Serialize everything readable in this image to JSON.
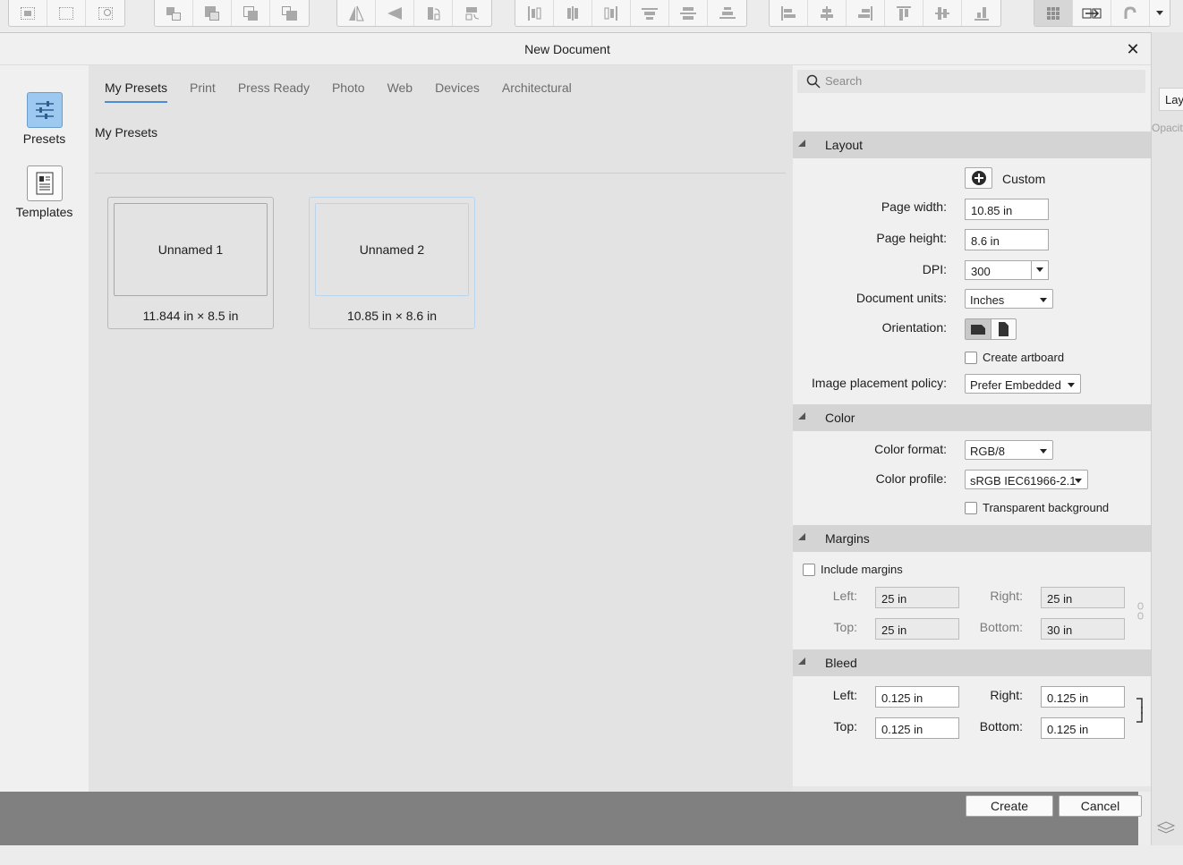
{
  "toolbar": {
    "groups": [
      {
        "name": "selection",
        "icons": [
          "select-all-icon",
          "deselect-icon",
          "invert-selection-icon"
        ]
      },
      {
        "name": "arrange",
        "icons": [
          "move-to-back-icon",
          "move-back-one-icon",
          "move-forward-one-icon",
          "move-to-front-icon"
        ]
      },
      {
        "name": "transform",
        "icons": [
          "flip-horizontal-icon",
          "flip-vertical-icon",
          "rotate-left-icon",
          "rotate-right-icon"
        ]
      },
      {
        "name": "distribute",
        "icons": [
          "align-left-icon",
          "align-center-icon",
          "align-right-icon",
          "distribute-top-icon",
          "distribute-middle-icon",
          "distribute-bottom-icon"
        ]
      },
      {
        "name": "align",
        "icons": [
          "align-left-edge-icon",
          "align-h-center-icon",
          "align-right-edge-icon",
          "align-top-icon",
          "align-v-center-icon",
          "align-bottom-icon"
        ]
      },
      {
        "name": "snapping",
        "icons": [
          "grid-icon",
          "swap-icon",
          "snapping-magnet-icon",
          "dropdown-arrow-icon"
        ]
      }
    ]
  },
  "side_panel": {
    "tab_label": "Layers",
    "opacity_label": "Opacity"
  },
  "dialog": {
    "title": "New Document",
    "close_symbol": "✕",
    "nav": [
      {
        "label": "Presets",
        "icon": "presets-sliders-icon"
      },
      {
        "label": "Templates",
        "icon": "templates-doc-icon"
      }
    ],
    "tabs": [
      "My Presets",
      "Print",
      "Press Ready",
      "Photo",
      "Web",
      "Devices",
      "Architectural"
    ],
    "section_label": "My Presets",
    "presets": [
      {
        "name": "Unnamed 1",
        "size": "11.844 in × 8.5 in"
      },
      {
        "name": "Unnamed 2",
        "size": "10.85 in × 8.6 in"
      }
    ],
    "search_placeholder": "Search",
    "layout": {
      "header": "Layout",
      "custom_label": "Custom",
      "page_width_label": "Page width:",
      "page_width": "10.85 in",
      "page_height_label": "Page height:",
      "page_height": "8.6 in",
      "dpi_label": "DPI:",
      "dpi": "300",
      "units_label": "Document units:",
      "units": "Inches",
      "orientation_label": "Orientation:",
      "artboard_label": "Create artboard",
      "placement_label": "Image placement policy:",
      "placement": "Prefer Embedded"
    },
    "color": {
      "header": "Color",
      "format_label": "Color format:",
      "format": "RGB/8",
      "profile_label": "Color profile:",
      "profile": "sRGB IEC61966-2.1",
      "transparent_label": "Transparent background"
    },
    "margins": {
      "header": "Margins",
      "include_label": "Include margins",
      "left_label": "Left:",
      "left": "25 in",
      "right_label": "Right:",
      "right": "25 in",
      "top_label": "Top:",
      "top": "25 in",
      "bottom_label": "Bottom:",
      "bottom": "30 in"
    },
    "bleed": {
      "header": "Bleed",
      "left_label": "Left:",
      "left": "0.125 in",
      "right_label": "Right:",
      "right": "0.125 in",
      "top_label": "Top:",
      "top": "0.125 in",
      "bottom_label": "Bottom:",
      "bottom": "0.125 in"
    },
    "create_label": "Create",
    "cancel_label": "Cancel"
  }
}
